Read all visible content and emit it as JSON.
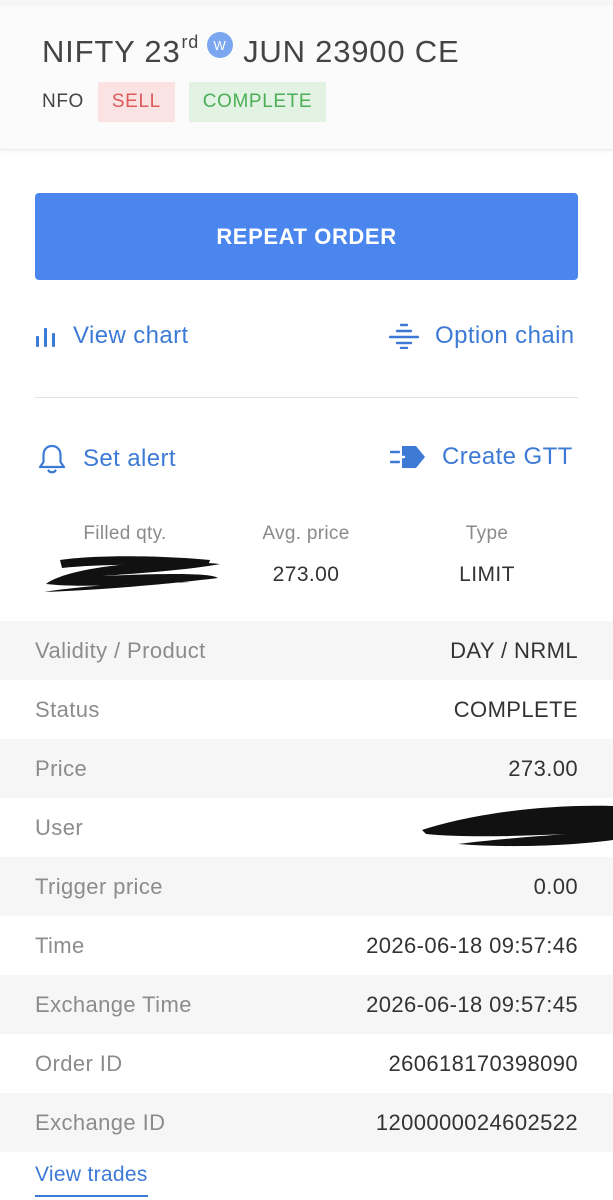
{
  "header": {
    "symbol": "NIFTY 23",
    "day_suffix": "rd",
    "weekly_badge": "W",
    "contract": "JUN 23900 CE",
    "exchange": "NFO",
    "side": "SELL",
    "status": "COMPLETE"
  },
  "actions": {
    "repeat_order": "REPEAT ORDER",
    "view_chart": "View chart",
    "option_chain": "Option chain",
    "set_alert": "Set alert",
    "create_gtt": "Create GTT"
  },
  "stats": {
    "filled_qty_label": "Filled qty.",
    "avg_price_label": "Avg. price",
    "avg_price": "273.00",
    "type_label": "Type",
    "type": "LIMIT"
  },
  "details": [
    {
      "key": "Validity / Product",
      "value": "DAY / NRML"
    },
    {
      "key": "Status",
      "value": "COMPLETE"
    },
    {
      "key": "Price",
      "value": "273.00"
    },
    {
      "key": "User",
      "value": ""
    },
    {
      "key": "Trigger price",
      "value": "0.00"
    },
    {
      "key": "Time",
      "value": "2026-06-18 09:57:46"
    },
    {
      "key": "Exchange Time",
      "value": "2026-06-18 09:57:45"
    },
    {
      "key": "Order ID",
      "value": "260618170398090"
    },
    {
      "key": "Exchange ID",
      "value": "1200000024602522"
    }
  ],
  "footer": {
    "view_trades": "View trades"
  },
  "colors": {
    "accent": "#3d7ad6",
    "button": "#4a86ee",
    "sell": "#df5a5a",
    "complete": "#4cae56"
  }
}
